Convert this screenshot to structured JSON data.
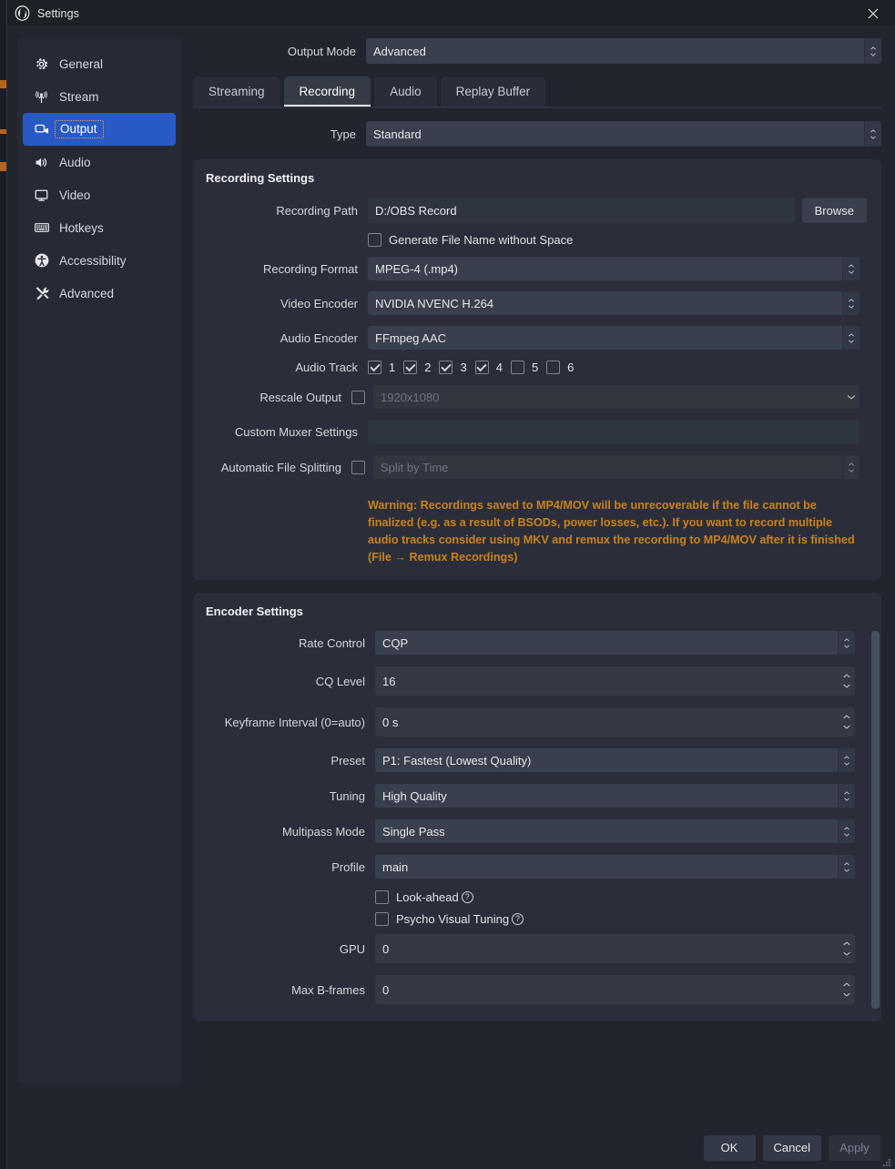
{
  "window": {
    "title": "Settings",
    "logo_icon": "obs-logo-icon",
    "close_icon": "close-icon"
  },
  "sidebar": {
    "items": [
      {
        "label": "General",
        "icon": "gear-icon",
        "selected": false
      },
      {
        "label": "Stream",
        "icon": "broadcast-icon",
        "selected": false
      },
      {
        "label": "Output",
        "icon": "output-screen-icon",
        "selected": true
      },
      {
        "label": "Audio",
        "icon": "speaker-icon",
        "selected": false
      },
      {
        "label": "Video",
        "icon": "monitor-icon",
        "selected": false
      },
      {
        "label": "Hotkeys",
        "icon": "keyboard-icon",
        "selected": false
      },
      {
        "label": "Accessibility",
        "icon": "accessibility-icon",
        "selected": false
      },
      {
        "label": "Advanced",
        "icon": "tools-icon",
        "selected": false
      }
    ]
  },
  "output_mode": {
    "label": "Output Mode",
    "value": "Advanced"
  },
  "tabs": [
    {
      "label": "Streaming",
      "active": false
    },
    {
      "label": "Recording",
      "active": true
    },
    {
      "label": "Audio",
      "active": false
    },
    {
      "label": "Replay Buffer",
      "active": false
    }
  ],
  "type_row": {
    "label": "Type",
    "value": "Standard"
  },
  "recording_settings": {
    "title": "Recording Settings",
    "recording_path": {
      "label": "Recording Path",
      "value": "D:/OBS Record",
      "browse_label": "Browse"
    },
    "generate_no_space": {
      "label": "Generate File Name without Space",
      "checked": false
    },
    "recording_format": {
      "label": "Recording Format",
      "value": "MPEG-4 (.mp4)"
    },
    "video_encoder": {
      "label": "Video Encoder",
      "value": "NVIDIA NVENC H.264"
    },
    "audio_encoder": {
      "label": "Audio Encoder",
      "value": "FFmpeg AAC"
    },
    "audio_track": {
      "label": "Audio Track",
      "tracks": [
        {
          "number": "1",
          "checked": true
        },
        {
          "number": "2",
          "checked": true
        },
        {
          "number": "3",
          "checked": true
        },
        {
          "number": "4",
          "checked": true
        },
        {
          "number": "5",
          "checked": false
        },
        {
          "number": "6",
          "checked": false
        }
      ]
    },
    "rescale_output": {
      "label": "Rescale Output",
      "checked": false,
      "value": "1920x1080",
      "enabled": false
    },
    "custom_muxer": {
      "label": "Custom Muxer Settings",
      "value": ""
    },
    "automatic_file_splitting": {
      "label": "Automatic File Splitting",
      "checked": false,
      "value": "Split by Time",
      "enabled": false
    },
    "warning": "Warning: Recordings saved to MP4/MOV will be unrecoverable if the file cannot be finalized (e.g. as a result of BSODs, power losses, etc.). If you want to record multiple audio tracks consider using MKV and remux the recording to MP4/MOV after it is finished (File → Remux Recordings)",
    "warning_color": "#c9821a"
  },
  "encoder_settings": {
    "title": "Encoder Settings",
    "rate_control": {
      "label": "Rate Control",
      "value": "CQP"
    },
    "cq_level": {
      "label": "CQ Level",
      "value": "16"
    },
    "keyframe_interval": {
      "label": "Keyframe Interval (0=auto)",
      "value": "0 s"
    },
    "preset": {
      "label": "Preset",
      "value": "P1: Fastest (Lowest Quality)"
    },
    "tuning": {
      "label": "Tuning",
      "value": "High Quality"
    },
    "multipass_mode": {
      "label": "Multipass Mode",
      "value": "Single Pass"
    },
    "profile": {
      "label": "Profile",
      "value": "main"
    },
    "look_ahead": {
      "label": "Look-ahead",
      "checked": false,
      "help_icon": "help-icon"
    },
    "psycho_visual": {
      "label": "Psycho Visual Tuning",
      "checked": false,
      "help_icon": "help-icon"
    },
    "gpu": {
      "label": "GPU",
      "value": "0"
    },
    "max_b_frames": {
      "label": "Max B-frames",
      "value": "0"
    }
  },
  "footer": {
    "ok_label": "OK",
    "cancel_label": "Cancel",
    "apply_label": "Apply",
    "apply_enabled": false
  },
  "colors": {
    "window_bg": "#22242e",
    "panel_bg": "#2b2e3a",
    "sidebar_bg": "#272a35",
    "accent_selected": "#2859c5",
    "focus_outline": "#f0a33a",
    "warning": "#c9821a",
    "control_bg": "#3a3f4d",
    "input_bg": "#2f3441"
  }
}
